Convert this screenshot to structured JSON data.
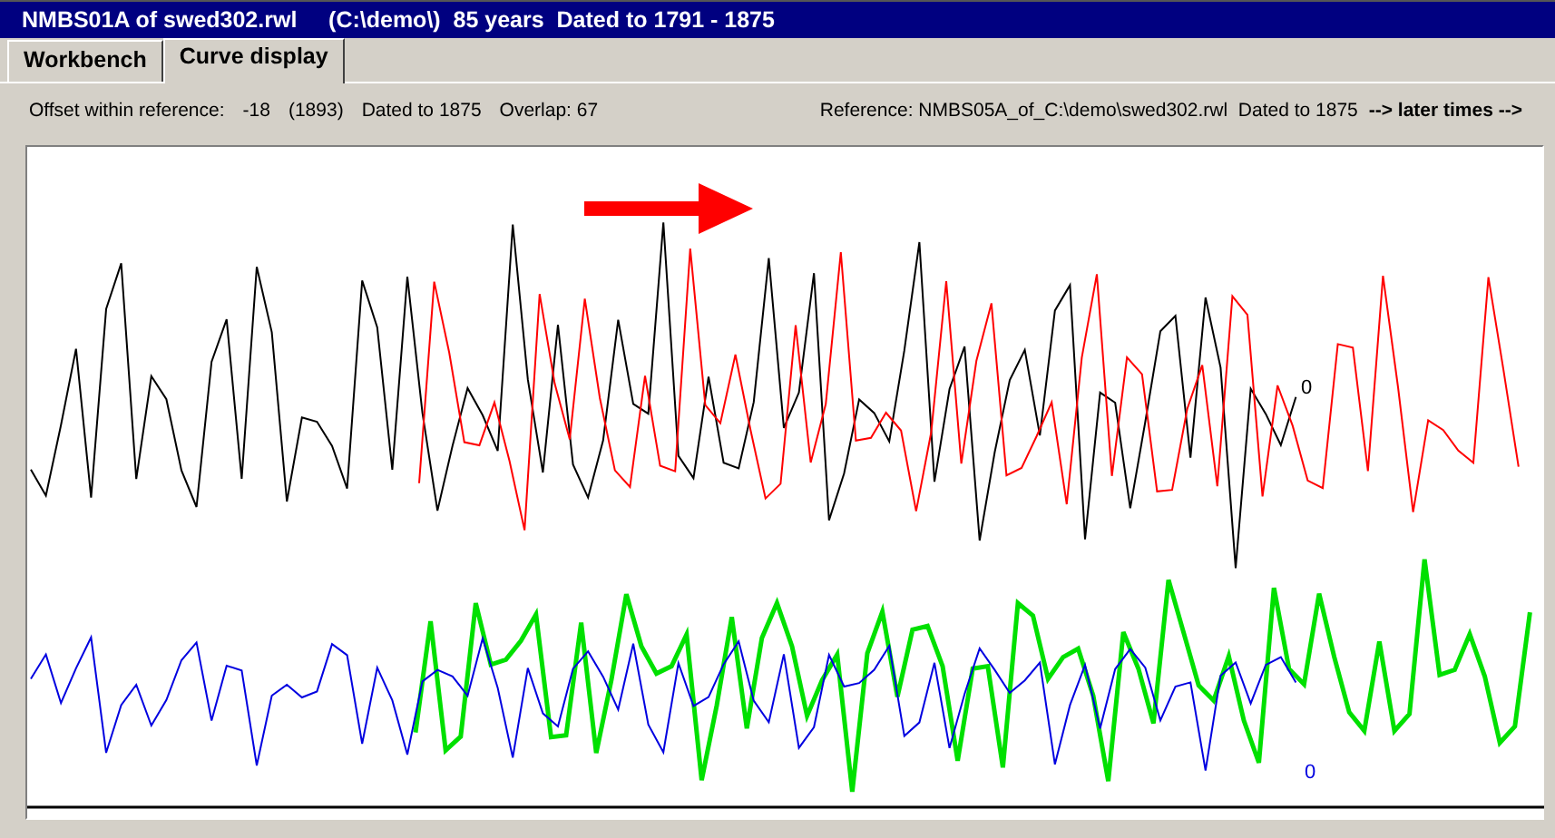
{
  "window": {
    "title": "NMBS01A of swed302.rwl     (C:\\demo\\)  85 years  Dated to 1791 - 1875"
  },
  "tabs": [
    {
      "label": "Workbench",
      "selected": false
    },
    {
      "label": "Curve display",
      "selected": true
    }
  ],
  "info": {
    "offset_label": "Offset within reference:",
    "offset_value": "-18",
    "offset_year": "(1893)",
    "dated": "Dated to 1875",
    "overlap": "Overlap: 67",
    "reference": "Reference: NMBS05A_of_C:\\demo\\swed302.rwl  Dated to 1875",
    "direction": "--> later times -->"
  },
  "chart": {
    "curve_end_labels": [
      "0",
      "0"
    ]
  }
}
